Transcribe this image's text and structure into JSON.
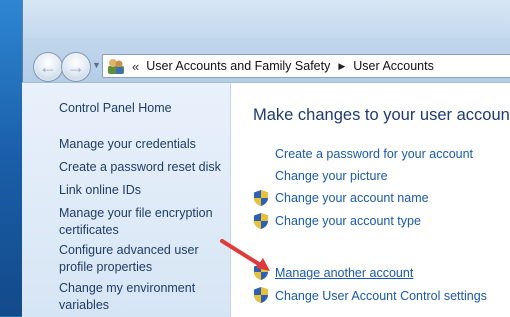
{
  "address": {
    "prefix": "«",
    "crumbs": [
      "User Accounts and Family Safety",
      "User Accounts"
    ]
  },
  "sidebar": {
    "items": [
      "Control Panel Home",
      "Manage your credentials",
      "Create a password reset disk",
      "Link online IDs",
      "Manage your file encryption certificates",
      "Configure advanced user profile properties",
      "Change my environment variables"
    ]
  },
  "main": {
    "title": "Make changes to your user account",
    "tasks": [
      "Create a password for your account",
      "Change your picture",
      "Change your account name",
      "Change your account type",
      "Manage another account",
      "Change User Account Control settings"
    ]
  },
  "colors": {
    "link": "#1a5aa6",
    "title": "#1e3a70",
    "annotation_arrow": "#e03a3a"
  },
  "icons": [
    "back-arrow-icon",
    "forward-arrow-icon",
    "user-accounts-icon",
    "uac-shield-icon"
  ]
}
